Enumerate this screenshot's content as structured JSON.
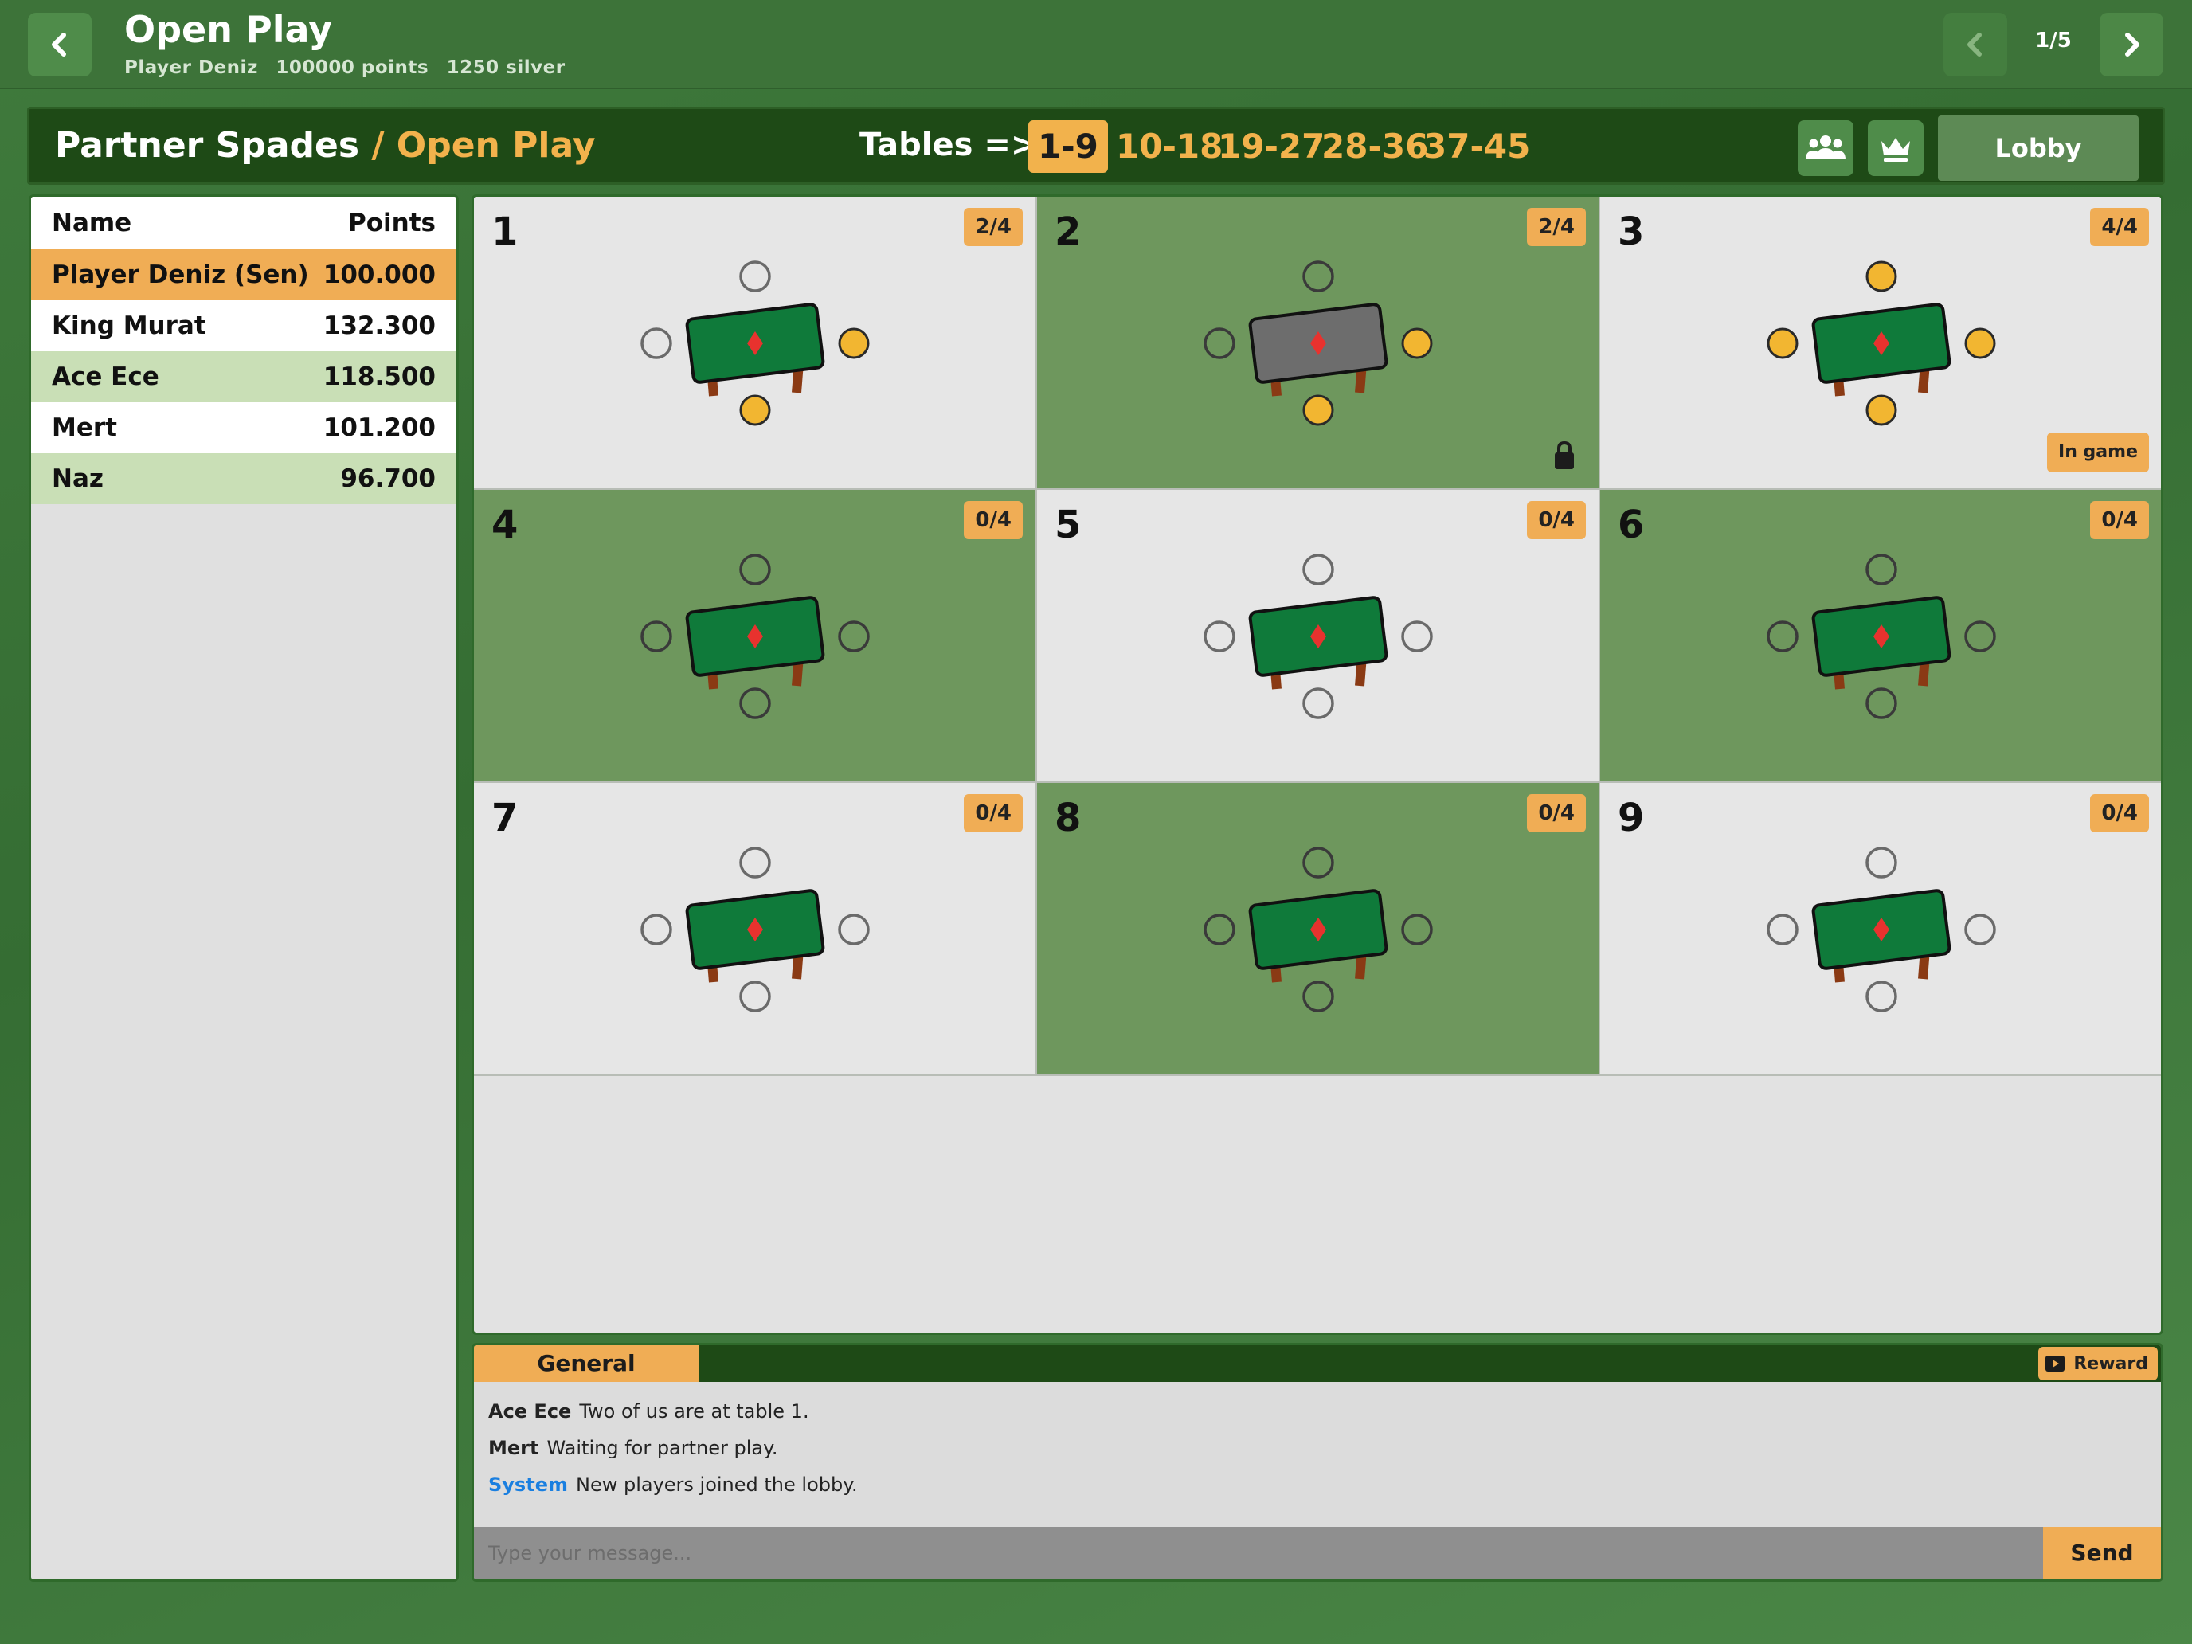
{
  "header": {
    "title": "Open Play",
    "player_name": "Player Deniz",
    "points": "100000 points",
    "silver": "1250 silver",
    "page_indicator": "1/5"
  },
  "section": {
    "game": "Partner Spades",
    "mode": "/ Open Play",
    "tables_label": "Tables =>",
    "ranges": [
      "1-9",
      "10-18",
      "19-27",
      "28-36",
      "37-45"
    ],
    "active_range": "1-9",
    "lobby_label": "Lobby"
  },
  "leaderboard": {
    "col_name": "Name",
    "col_points": "Points",
    "rows": [
      {
        "name": "Player Deniz (Sen)",
        "points": "100.000"
      },
      {
        "name": "King Murat",
        "points": "132.300"
      },
      {
        "name": "Ace Ece",
        "points": "118.500"
      },
      {
        "name": "Mert",
        "points": "101.200"
      },
      {
        "name": "Naz",
        "points": "96.700"
      }
    ]
  },
  "tables": [
    {
      "number": "1",
      "occupancy": "2/4",
      "seats": {
        "top": false,
        "left": false,
        "right": true,
        "bottom": true
      },
      "locked": false,
      "status": ""
    },
    {
      "number": "2",
      "occupancy": "2/4",
      "seats": {
        "top": false,
        "left": false,
        "right": true,
        "bottom": true
      },
      "locked": true,
      "status": ""
    },
    {
      "number": "3",
      "occupancy": "4/4",
      "seats": {
        "top": true,
        "left": true,
        "right": true,
        "bottom": true
      },
      "locked": false,
      "status": "In game"
    },
    {
      "number": "4",
      "occupancy": "0/4",
      "seats": {
        "top": false,
        "left": false,
        "right": false,
        "bottom": false
      },
      "locked": false,
      "status": ""
    },
    {
      "number": "5",
      "occupancy": "0/4",
      "seats": {
        "top": false,
        "left": false,
        "right": false,
        "bottom": false
      },
      "locked": false,
      "status": ""
    },
    {
      "number": "6",
      "occupancy": "0/4",
      "seats": {
        "top": false,
        "left": false,
        "right": false,
        "bottom": false
      },
      "locked": false,
      "status": ""
    },
    {
      "number": "7",
      "occupancy": "0/4",
      "seats": {
        "top": false,
        "left": false,
        "right": false,
        "bottom": false
      },
      "locked": false,
      "status": ""
    },
    {
      "number": "8",
      "occupancy": "0/4",
      "seats": {
        "top": false,
        "left": false,
        "right": false,
        "bottom": false
      },
      "locked": false,
      "status": ""
    },
    {
      "number": "9",
      "occupancy": "0/4",
      "seats": {
        "top": false,
        "left": false,
        "right": false,
        "bottom": false
      },
      "locked": false,
      "status": ""
    }
  ],
  "chat": {
    "tab": "General",
    "reward": "Reward",
    "messages": [
      {
        "author": "Ace Ece",
        "text": "Two of us are at table 1.",
        "system": false
      },
      {
        "author": "Mert",
        "text": "Waiting for partner play.",
        "system": false
      },
      {
        "author": "System",
        "text": "New players joined the lobby.",
        "system": true
      }
    ],
    "placeholder": "Type your message...",
    "send": "Send"
  },
  "colors": {
    "accent": "#f0ad55",
    "dark_green": "#1e4a16",
    "felt": "#0f7a3a",
    "seat_taken": "#f2b631",
    "system_name": "#1a7fe0"
  },
  "icons": [
    "chevron-left-icon",
    "chevron-right-icon",
    "friends-icon",
    "crown-icon",
    "lock-icon",
    "video-icon",
    "diamond-icon"
  ]
}
